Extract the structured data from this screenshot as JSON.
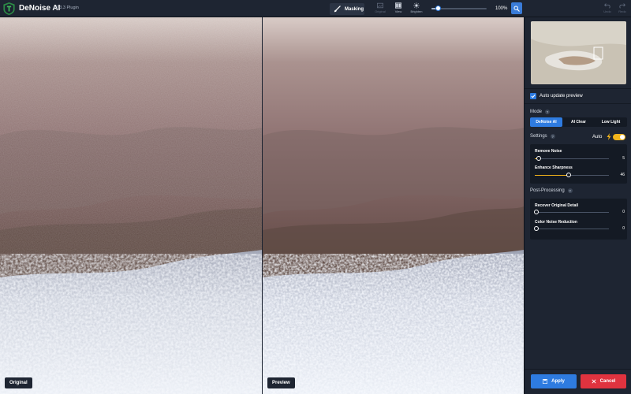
{
  "app": {
    "title": "DeNoise AI",
    "version": "v2.3.3 Plugin",
    "logo_icon": "topaz-shield-logo"
  },
  "toolbar": {
    "masking_label": "Masking",
    "original_label": "Original",
    "view_label": "View",
    "brighten_label": "Brighten",
    "zoom_value": "100%",
    "zoom_level_fraction": 0.1,
    "undo_label": "Undo",
    "redo_label": "Redo"
  },
  "panes": {
    "left_label": "Original",
    "right_label": "Preview"
  },
  "sidebar": {
    "auto_update_label": "Auto update preview",
    "auto_update_checked": true,
    "mode_label": "Mode",
    "modes": [
      "DeNoise AI",
      "AI Clear",
      "Low Light"
    ],
    "active_mode": "DeNoise AI",
    "settings_label": "Settings",
    "auto_label": "Auto",
    "auto_enabled": true,
    "sliders": [
      {
        "label": "Remove Noise",
        "value": "5",
        "fraction": 0.05
      },
      {
        "label": "Enhance Sharpness",
        "value": "46",
        "fraction": 0.46
      }
    ],
    "post_processing_label": "Post-Processing",
    "post_sliders": [
      {
        "label": "Recover Original Detail",
        "value": "0",
        "fraction": 0
      },
      {
        "label": "Color Noise Reduction",
        "value": "0",
        "fraction": 0
      }
    ],
    "apply_label": "Apply",
    "cancel_label": "Cancel"
  },
  "colors": {
    "accent": "#2e7be0",
    "toggle": "#f2b41b",
    "cancel": "#e0333f",
    "panel_bg": "#1e2532"
  }
}
